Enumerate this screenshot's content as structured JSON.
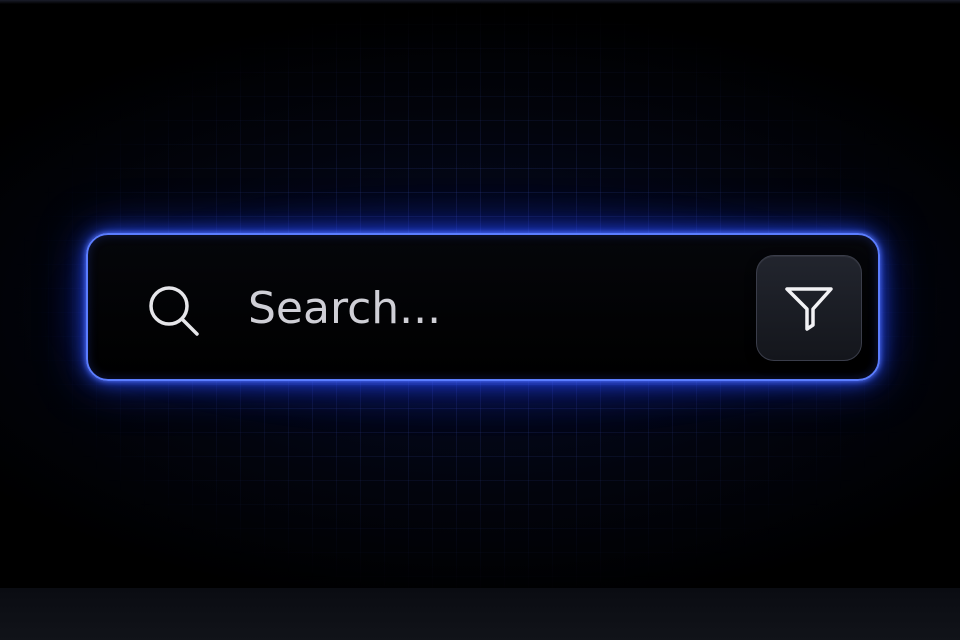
{
  "search": {
    "placeholder": "Search...",
    "value": "",
    "search_icon": "search-icon",
    "filter_icon": "filter-funnel-icon"
  },
  "colors": {
    "background": "#000000",
    "accent_glow": "#4a6cff",
    "border": "#5b7dff",
    "text": "#cfcfd6",
    "button_bg": "#1c1e26"
  }
}
